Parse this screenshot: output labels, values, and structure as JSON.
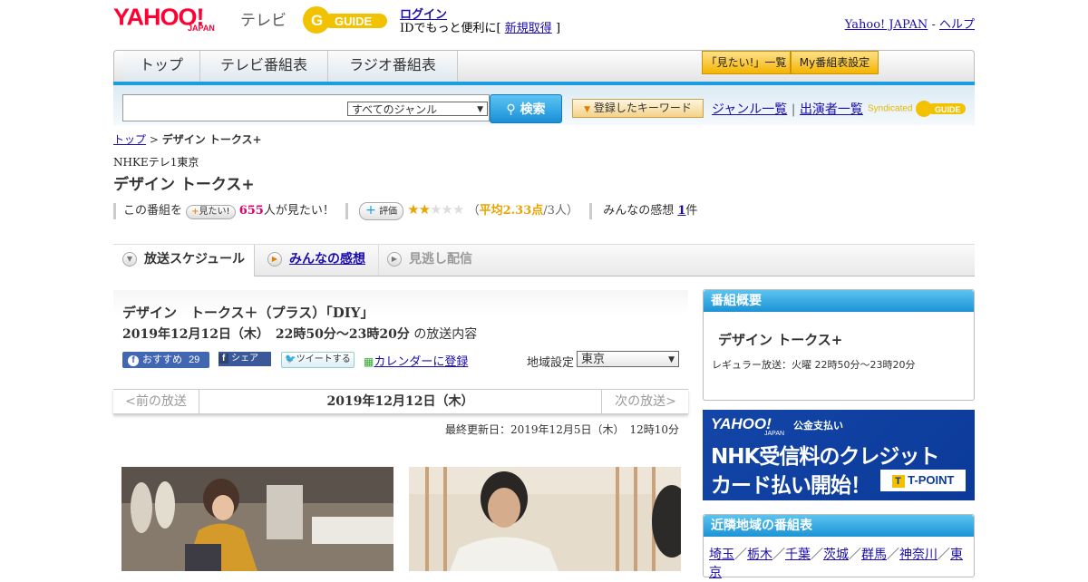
{
  "header": {
    "logo_text": "YAHOO!",
    "logo_sub": "JAPAN",
    "service_name": "テレビ",
    "guide_logo_text": "G GUIDE",
    "login_link": "ログイン",
    "login_sub_prefix": "IDでもっと便利に[",
    "signup_link": "新規取得",
    "login_sub_suffix": "]",
    "yahoo_japan_link": "Yahoo! JAPAN",
    "separator": " - ",
    "help_link": "ヘルプ"
  },
  "nav": {
    "tabs": [
      "トップ",
      "テレビ番組表",
      "ラジオ番組表"
    ],
    "want_list": "「見たい!」一覧",
    "my_schedule": "My番組表設定"
  },
  "search": {
    "input_value": "",
    "genre_select": "すべてのジャンル",
    "search_button": "検索",
    "keyword_button": "登録したキーワード",
    "genre_list_link": "ジャンル一覧",
    "divider": "|",
    "performer_list_link": "出演者一覧",
    "syndicated": "Syndicated"
  },
  "breadcrumb": {
    "top": "トップ",
    "sep": " > ",
    "current": "デザイン トークス+"
  },
  "program": {
    "station": "NHKEテレ1東京",
    "title": "デザイン トークス+",
    "want_prefix": "この番組を",
    "want_button": "見たい!",
    "want_count": "655",
    "want_suffix": "人が見たい！",
    "rate_button": "評価",
    "rating": 2.33,
    "rating_open": "（",
    "rating_avg": "平均2.33点",
    "rating_count": "/3人）",
    "impressions_prefix": "みんなの感想",
    "impressions_count": "1",
    "impressions_suffix": "件"
  },
  "schedule_tabs": [
    "放送スケジュール",
    "みんなの感想",
    "見逃し配信"
  ],
  "episode": {
    "title": "デザイン　トークス＋（プラス）「DIY」",
    "datetime": "2019年12月12日（木）　22時50分～23時20分",
    "datetime_suffix": "の放送内容",
    "fb_recommend": "おすすめ",
    "fb_count": "29",
    "fb_share": "シェア",
    "tweet": "ツイートする",
    "calendar": "カレンダーに登録",
    "region_label": "地域設定",
    "region_value": "東京",
    "prev": "<前の放送",
    "current_date": "2019年12月12日（木）",
    "next": "次の放送>",
    "updated": "最終更新日：2019年12月5日（木）　12時10分"
  },
  "sidebar": {
    "overview_header": "番組概要",
    "overview_title": "デザイン トークス+",
    "overview_regular": "レギュラー放送：火曜 22時50分～23時20分",
    "banner_brand": "YAHOO!",
    "banner_brand_sub": "JAPAN",
    "banner_tag": "公金支払い",
    "banner_line1": "NHK受信料のクレジット",
    "banner_line2": "カード払い開始！",
    "banner_tpoint": "T-POINT",
    "nearby_header": "近隣地域の番組表",
    "nearby_regions": [
      "埼玉",
      "栃木",
      "千葉",
      "茨城",
      "群馬",
      "神奈川",
      "東京"
    ]
  },
  "colors": {
    "accent_blue": "#1b9de0",
    "brand_red": "#ff0033",
    "want_count": "#e0006a",
    "rating": "#e8a400"
  }
}
